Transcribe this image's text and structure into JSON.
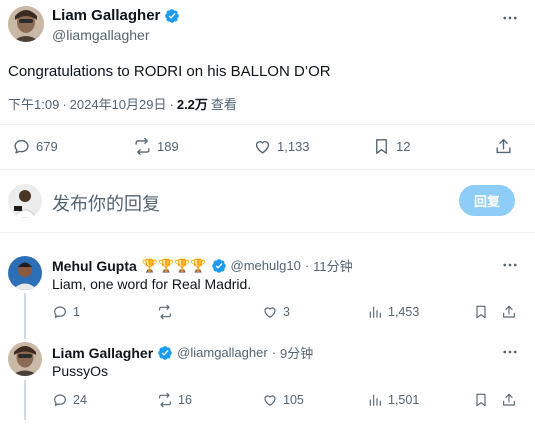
{
  "main_tweet": {
    "author_name": "Liam Gallagher",
    "author_handle": "@liamgallagher",
    "text": "Congratulations to RODRI on his BALLON D’OR",
    "time": "下午1:09",
    "dot": "·",
    "date": "2024年10月29日",
    "views_count": "2.2万",
    "views_label": "查看",
    "stats": {
      "replies": "679",
      "reposts": "189",
      "likes": "1,133",
      "bookmarks": "12"
    }
  },
  "compose": {
    "placeholder": "发布你的回复",
    "reply_button": "回复"
  },
  "replies": [
    {
      "author_name": "Mehul Gupta",
      "badges": "🏆🏆🏆🏆",
      "author_handle": "@mehulg10",
      "dot": "·",
      "time_ago": "11分钟",
      "text": "Liam, one word for Real Madrid.",
      "stats": {
        "replies": "1",
        "reposts": "",
        "likes": "3",
        "views": "1,453"
      }
    },
    {
      "author_name": "Liam Gallagher",
      "author_handle": "@liamgallagher",
      "dot": "·",
      "time_ago": "9分钟",
      "text": "PussyOs",
      "stats": {
        "replies": "24",
        "reposts": "16",
        "likes": "105",
        "views": "1,501"
      }
    }
  ],
  "colors": {
    "accent": "#1d9bf0",
    "reply_button_disabled": "#8ecdf8",
    "muted": "#536471",
    "divider": "#eff3f4"
  }
}
